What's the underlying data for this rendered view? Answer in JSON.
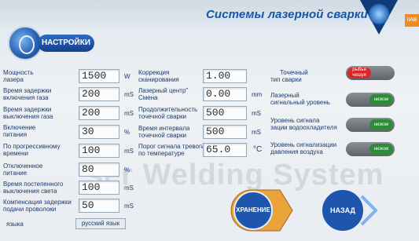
{
  "header": {
    "title": "Системы лазерной сварки",
    "corner_badge": "IIAB"
  },
  "settings_tab": "НАСТРОЙКИ",
  "watermark": "ser Welding System",
  "left": {
    "power": {
      "label_1": "Мощность",
      "label_2": "лазера",
      "value": "1500",
      "unit": "W"
    },
    "gas_on_delay": {
      "label_1": "Время задержки",
      "label_2": "включения газа",
      "value": "200",
      "unit": "mS"
    },
    "gas_off_delay": {
      "label_1": "Время задержки",
      "label_2": "выключения газа",
      "value": "200",
      "unit": "mS"
    },
    "power_on": {
      "label_1": "Включение",
      "label_2": "питания",
      "value": "30",
      "unit": "%"
    },
    "progressive_time": {
      "label_1": "По прогрессивному",
      "label_2": "времени",
      "value": "100",
      "unit": "mS"
    },
    "power_off": {
      "label_1": "Отключенное",
      "label_2": "питание",
      "value": "80",
      "unit": "%"
    },
    "light_off_time": {
      "label_1": "Время постепенного",
      "label_2": "выключения света",
      "value": "100",
      "unit": "mS"
    },
    "wire_feed_comp": {
      "label_1": "Компенсация задержки",
      "label_2": "подачи проволоки",
      "value": "50",
      "unit": "mS"
    },
    "language": {
      "label": "языка",
      "button": "русский язык"
    }
  },
  "middle": {
    "scan_correction": {
      "label_1": "Коррекция",
      "label_2": "сканирования",
      "value": "1.00"
    },
    "laser_center": {
      "label_1": "Лазерный центр\"",
      "label_2": "Смена",
      "value": "0.00",
      "unit": "mm"
    },
    "dot_duration": {
      "label_1": "Продолжительность",
      "label_2": "точечной сварки",
      "value": "500",
      "unit": "mS"
    },
    "dot_interval": {
      "label_1": "Время интервала",
      "label_2": "точечной сварки",
      "value": "500",
      "unit": "mS"
    },
    "temp_alarm": {
      "label_1": "Порог сигнала тревоги",
      "label_2": "по температуре",
      "value": "65.0",
      "unit": "°C"
    }
  },
  "right": {
    "dot_type": {
      "label_1": "Точечный",
      "label_2": "тип сварки",
      "toggle_text": "рыбья чешуя",
      "toggle_color": "#d8262c"
    },
    "laser_signal": {
      "label_1": "Лазерный",
      "label_2": "сигнальный уровень",
      "toggle_text": "низкое",
      "toggle_color": "#2e8b3a"
    },
    "chiller_signal": {
      "label_1": "Уровень сигнала",
      "label_2": "зации водоохладителя",
      "toggle_text": "низкое",
      "toggle_color": "#2e8b3a"
    },
    "air_pressure_signal": {
      "label_1": "Уровень сигнализации",
      "label_2": "давления воздуха",
      "toggle_text": "низкое",
      "toggle_color": "#2e8b3a"
    }
  },
  "actions": {
    "save": "ХРАНЕНИЕ",
    "back": "НАЗАД"
  }
}
